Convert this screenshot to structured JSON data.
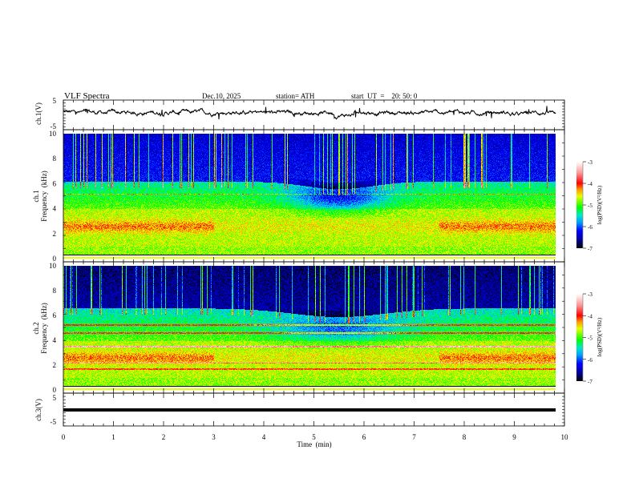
{
  "header": {
    "title": "VLF  Spectra",
    "date": "Dec.10, 2025",
    "station": "station= ATH",
    "start_ut": "start  UT  =    20: 50: 0"
  },
  "colors": {
    "line": "#000000",
    "axis": "#000000"
  },
  "chart_data": [
    {
      "type": "line",
      "name": "ch1-waveform",
      "ylabel": "ch.1(V)",
      "ylim": [
        -5,
        5
      ],
      "yticks": [
        "5",
        "-5"
      ],
      "xlim": [
        0,
        10
      ],
      "data_end_min": 9.83
    },
    {
      "type": "heatmap",
      "name": "ch1-spectrogram",
      "ylabel_channel": "ch.1",
      "ylabel": "Frequency  (kHz)",
      "ylim": [
        0,
        10
      ],
      "yticks": [
        "0",
        "2",
        "4",
        "6",
        "8",
        "10"
      ],
      "colorbar": {
        "label": "log(PSD)(V²/Hz)",
        "range": [
          -7,
          -3
        ],
        "ticks": [
          "-3",
          "-4",
          "-5",
          "-6",
          "-7"
        ]
      }
    },
    {
      "type": "heatmap",
      "name": "ch2-spectrogram",
      "ylabel_channel": "ch.2",
      "ylabel": "Frequency  (kHz)",
      "ylim": [
        0,
        10
      ],
      "yticks": [
        "0",
        "2",
        "4",
        "6",
        "8",
        "10"
      ],
      "colorbar": {
        "label": "log(PSD)(V²/Hz)",
        "range": [
          -7,
          -3
        ],
        "ticks": [
          "-3",
          "-4",
          "-5",
          "-6",
          "-7"
        ]
      }
    },
    {
      "type": "line",
      "name": "ch3-waveform",
      "ylabel": "ch.3(V)",
      "ylim": [
        -5,
        5
      ],
      "yticks": [
        "5",
        "-5"
      ],
      "level": 0
    }
  ],
  "xaxis": {
    "label": "Time  (min)",
    "ticks": [
      "0",
      "1",
      "2",
      "3",
      "4",
      "5",
      "6",
      "7",
      "8",
      "9",
      "10"
    ]
  }
}
